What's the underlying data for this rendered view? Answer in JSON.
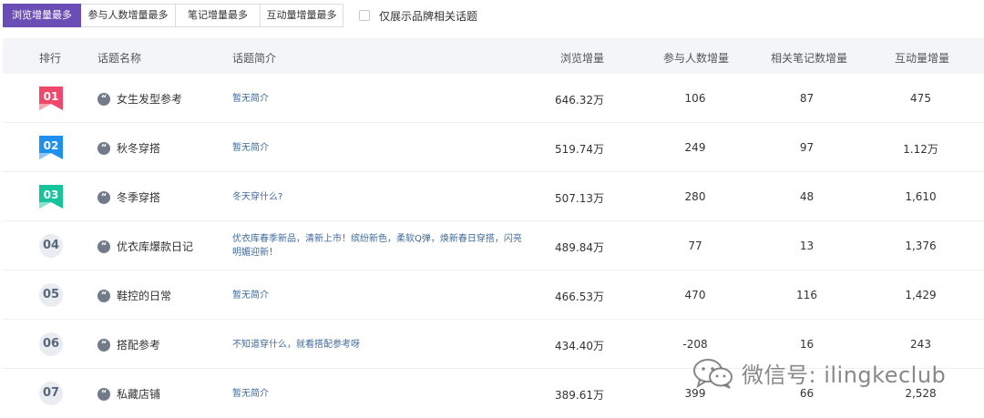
{
  "tabs": [
    {
      "label": "浏览增量最多",
      "active": true
    },
    {
      "label": "参与人数增量最多",
      "active": false
    },
    {
      "label": "笔记增量最多",
      "active": false
    },
    {
      "label": "互动量增量最多",
      "active": false
    }
  ],
  "filter": {
    "label": "仅展示品牌相关话题",
    "checked": false
  },
  "table": {
    "headers": {
      "rank": "排行",
      "topic": "话题名称",
      "intro": "话题简介",
      "views": "浏览增量",
      "participants": "参与人数增量",
      "notes": "相关笔记数增量",
      "interactions": "互动量增量"
    },
    "rows": [
      {
        "rank": "01",
        "name": "女生发型参考",
        "intro": "暂无简介",
        "views": "646.32万",
        "participants": "106",
        "notes": "87",
        "interactions": "475"
      },
      {
        "rank": "02",
        "name": "秋冬穿搭",
        "intro": "暂无简介",
        "views": "519.74万",
        "participants": "249",
        "notes": "97",
        "interactions": "1.12万"
      },
      {
        "rank": "03",
        "name": "冬季穿搭",
        "intro": "冬天穿什么?",
        "views": "507.13万",
        "participants": "280",
        "notes": "48",
        "interactions": "1,610"
      },
      {
        "rank": "04",
        "name": "优衣库爆款日记",
        "intro": "优衣库春季新品，清新上市！缤纷新色，柔软Q弹，焕新春日穿搭，闪亮明媚迎新！",
        "views": "489.84万",
        "participants": "77",
        "notes": "13",
        "interactions": "1,376"
      },
      {
        "rank": "05",
        "name": "鞋控的日常",
        "intro": "暂无简介",
        "views": "466.53万",
        "participants": "470",
        "notes": "116",
        "interactions": "1,429"
      },
      {
        "rank": "06",
        "name": "搭配参考",
        "intro": "不知道穿什么，就看搭配参考呀",
        "views": "434.40万",
        "participants": "-208",
        "notes": "16",
        "interactions": "243"
      },
      {
        "rank": "07",
        "name": "私藏店铺",
        "intro": "暂无简介",
        "views": "389.61万",
        "participants": "399",
        "notes": "66",
        "interactions": "2,528"
      }
    ]
  },
  "colors": {
    "accent": "#6b4eb5",
    "rank1": "#f0486a",
    "rank2": "#1f8ff0",
    "rank3": "#17c39a",
    "intro_text": "#3f6a9c"
  },
  "icons": {
    "topic": "quote-icon",
    "watermark": "wechat-icon"
  },
  "watermark": {
    "text": "微信号: ilingkeclub"
  }
}
